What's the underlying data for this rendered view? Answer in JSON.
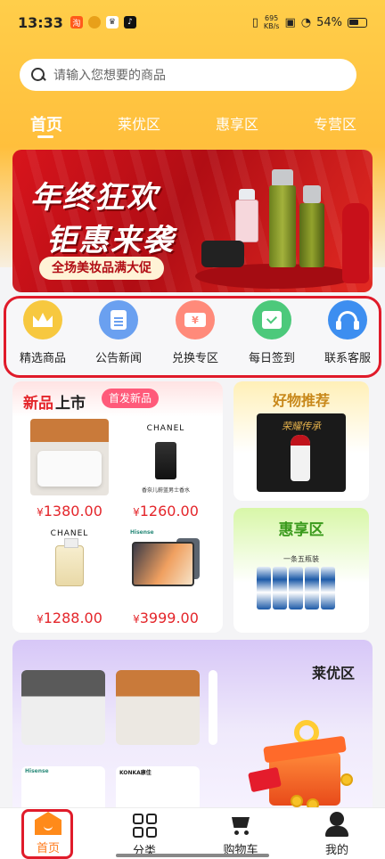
{
  "status_bar": {
    "time": "13:33",
    "net_speed_value": "695",
    "net_speed_unit": "KB/s",
    "battery": "54%"
  },
  "search": {
    "placeholder": "请输入您想要的商品"
  },
  "tabs": [
    {
      "label": "首页",
      "active": true
    },
    {
      "label": "莱优区"
    },
    {
      "label": "惠享区"
    },
    {
      "label": "专营区"
    }
  ],
  "banner": {
    "title_line1": "年终狂欢",
    "title_line2": "钜惠来袭",
    "subtitle": "全场美妆品满大促"
  },
  "quick_entries": [
    {
      "label": "精选商品",
      "icon": "crown-icon",
      "color": "#f7c83f"
    },
    {
      "label": "公告新闻",
      "icon": "document-icon",
      "color": "#6aa0f0"
    },
    {
      "label": "兑换专区",
      "icon": "ticket-icon",
      "color": "#ff8a7a"
    },
    {
      "label": "每日签到",
      "icon": "calendar-check-icon",
      "color": "#4cc97b"
    },
    {
      "label": "联系客服",
      "icon": "headset-icon",
      "color": "#3d8ef0"
    }
  ],
  "new_arrivals": {
    "title_red": "新品",
    "title_dark": "上市",
    "badge": "首发新品",
    "products": [
      {
        "price": "1380.00",
        "image": "bedding"
      },
      {
        "price": "1260.00",
        "image": "chanel-bleu",
        "brand": "CHANEL",
        "caption": "香奈儿蔚蓝男士香水"
      },
      {
        "price": "1288.00",
        "image": "chanel-no5",
        "brand": "CHANEL"
      },
      {
        "price": "3999.00",
        "image": "hisense-tablet",
        "brand": "Hisense"
      }
    ],
    "currency": "¥"
  },
  "recommend": {
    "title": "好物推荐",
    "image_text": "荣耀传承"
  },
  "huixiang": {
    "title": "惠享区",
    "caption": "一条五瓶装"
  },
  "laiyou": {
    "title": "莱优区",
    "mini_labels": [
      "Hisense",
      "KONKA康佳"
    ]
  },
  "bottom_nav": [
    {
      "label": "首页",
      "icon": "home-icon",
      "active": true
    },
    {
      "label": "分类",
      "icon": "category-icon"
    },
    {
      "label": "购物车",
      "icon": "cart-icon"
    },
    {
      "label": "我的",
      "icon": "user-icon"
    }
  ],
  "colors": {
    "accent": "#ffbf3c",
    "price": "#e4262b",
    "highlight_outline": "#e01b2a",
    "nav_active": "#ff7a1a"
  }
}
